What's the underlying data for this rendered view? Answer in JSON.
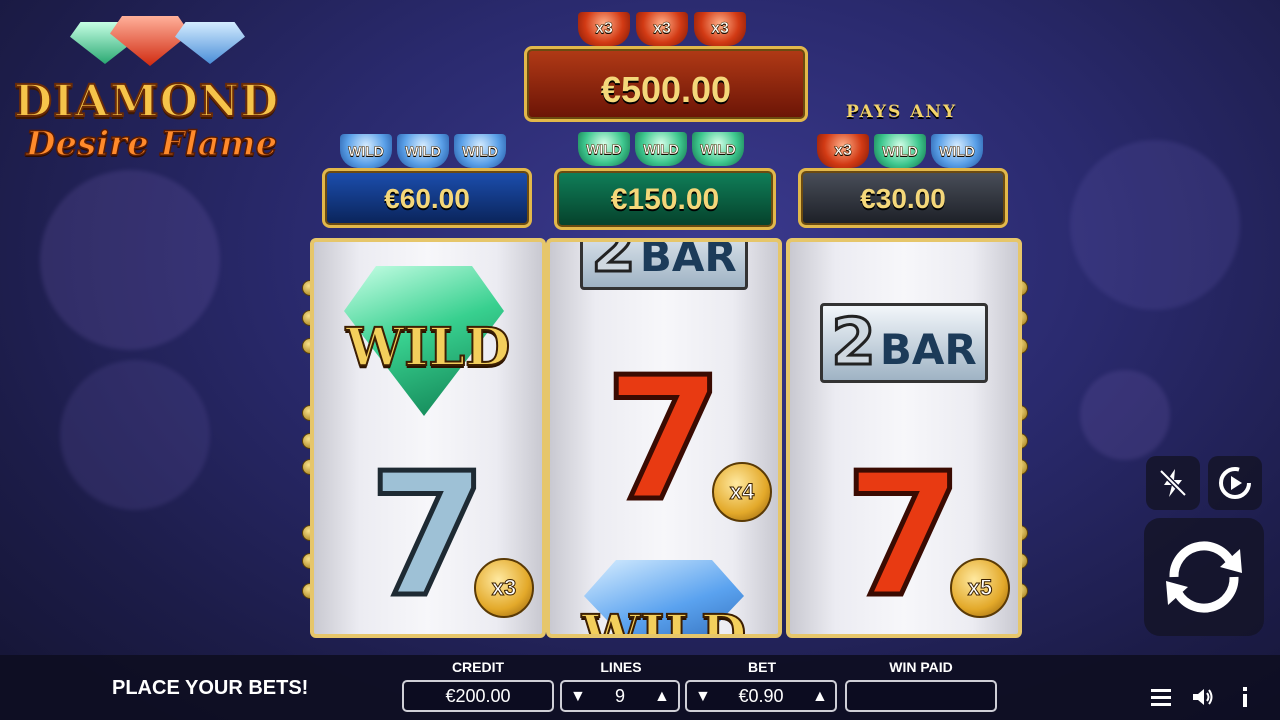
{
  "game": {
    "title_line1": "DIAMOND",
    "title_line2": "Desire Flame"
  },
  "jackpots": {
    "top": {
      "multipliers": [
        "x3",
        "x3",
        "x3"
      ],
      "amount": "€500.00"
    },
    "blue": {
      "labels": [
        "WILD",
        "WILD",
        "WILD"
      ],
      "amount": "€60.00"
    },
    "green": {
      "labels": [
        "WILD",
        "WILD",
        "WILD"
      ],
      "amount": "€150.00"
    },
    "any": {
      "heading": "PAYS ANY",
      "labels": [
        "x3",
        "WILD",
        "WILD"
      ],
      "amount": "€30.00"
    }
  },
  "reels": {
    "reel1": {
      "top_label": "WILD",
      "bottom_symbol": "7",
      "bottom_multiplier": "x3"
    },
    "reel2": {
      "top_partial": "BAR",
      "top_partial_num": "2",
      "middle_symbol": "7",
      "middle_multiplier": "x4",
      "bottom_partial": "WILD"
    },
    "reel3": {
      "top_num": "2",
      "top_label": "BAR",
      "bottom_symbol": "7",
      "bottom_multiplier": "x5"
    }
  },
  "status": {
    "message": "PLACE YOUR BETS!",
    "credit_label": "CREDIT",
    "credit_value": "€200.00",
    "lines_label": "LINES",
    "lines_value": "9",
    "bet_label": "BET",
    "bet_value": "€0.90",
    "winpaid_label": "WIN PAID",
    "winpaid_value": ""
  },
  "controls": {
    "turbo_icon": "lightning-off-icon",
    "autoplay_icon": "autoplay-icon",
    "spin_icon": "spin-icon",
    "menu_icon": "menu-icon",
    "sound_icon": "sound-icon",
    "info_icon": "info-icon"
  }
}
